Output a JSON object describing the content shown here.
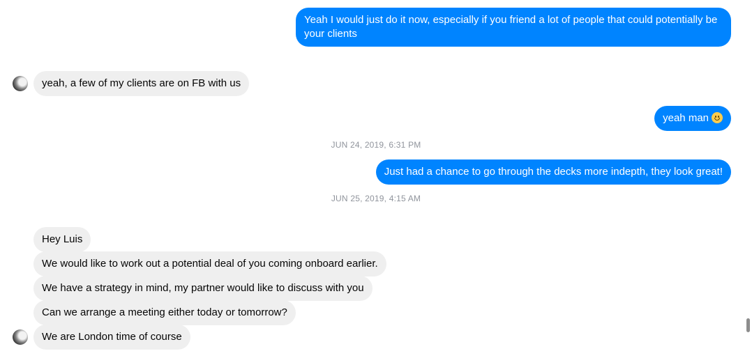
{
  "messages": {
    "m1": "Yeah I would just do it now, especially if you friend a lot of people that could potentially be your clients",
    "m2": "yeah, a few of my clients are on FB with us",
    "m3": "yeah man",
    "m3_emoji": "slightly-smiling-face-icon",
    "ts1": "JUN 24, 2019, 6:31 PM",
    "m4": "Just had a chance to go through the decks more indepth, they look great!",
    "ts2": "JUN 25, 2019, 4:15 AM",
    "m5": "Hey Luis",
    "m6": "We would like to work out a potential deal of you coming onboard earlier.",
    "m7": "We have a strategy in mind, my partner would like to discuss with you",
    "m8": "Can we arrange a meeting either today or tomorrow?",
    "m9": "We are London time of course"
  },
  "colors": {
    "outgoing_bubble": "#0084ff",
    "incoming_bubble": "#efefef",
    "timestamp_text": "#90949c"
  }
}
